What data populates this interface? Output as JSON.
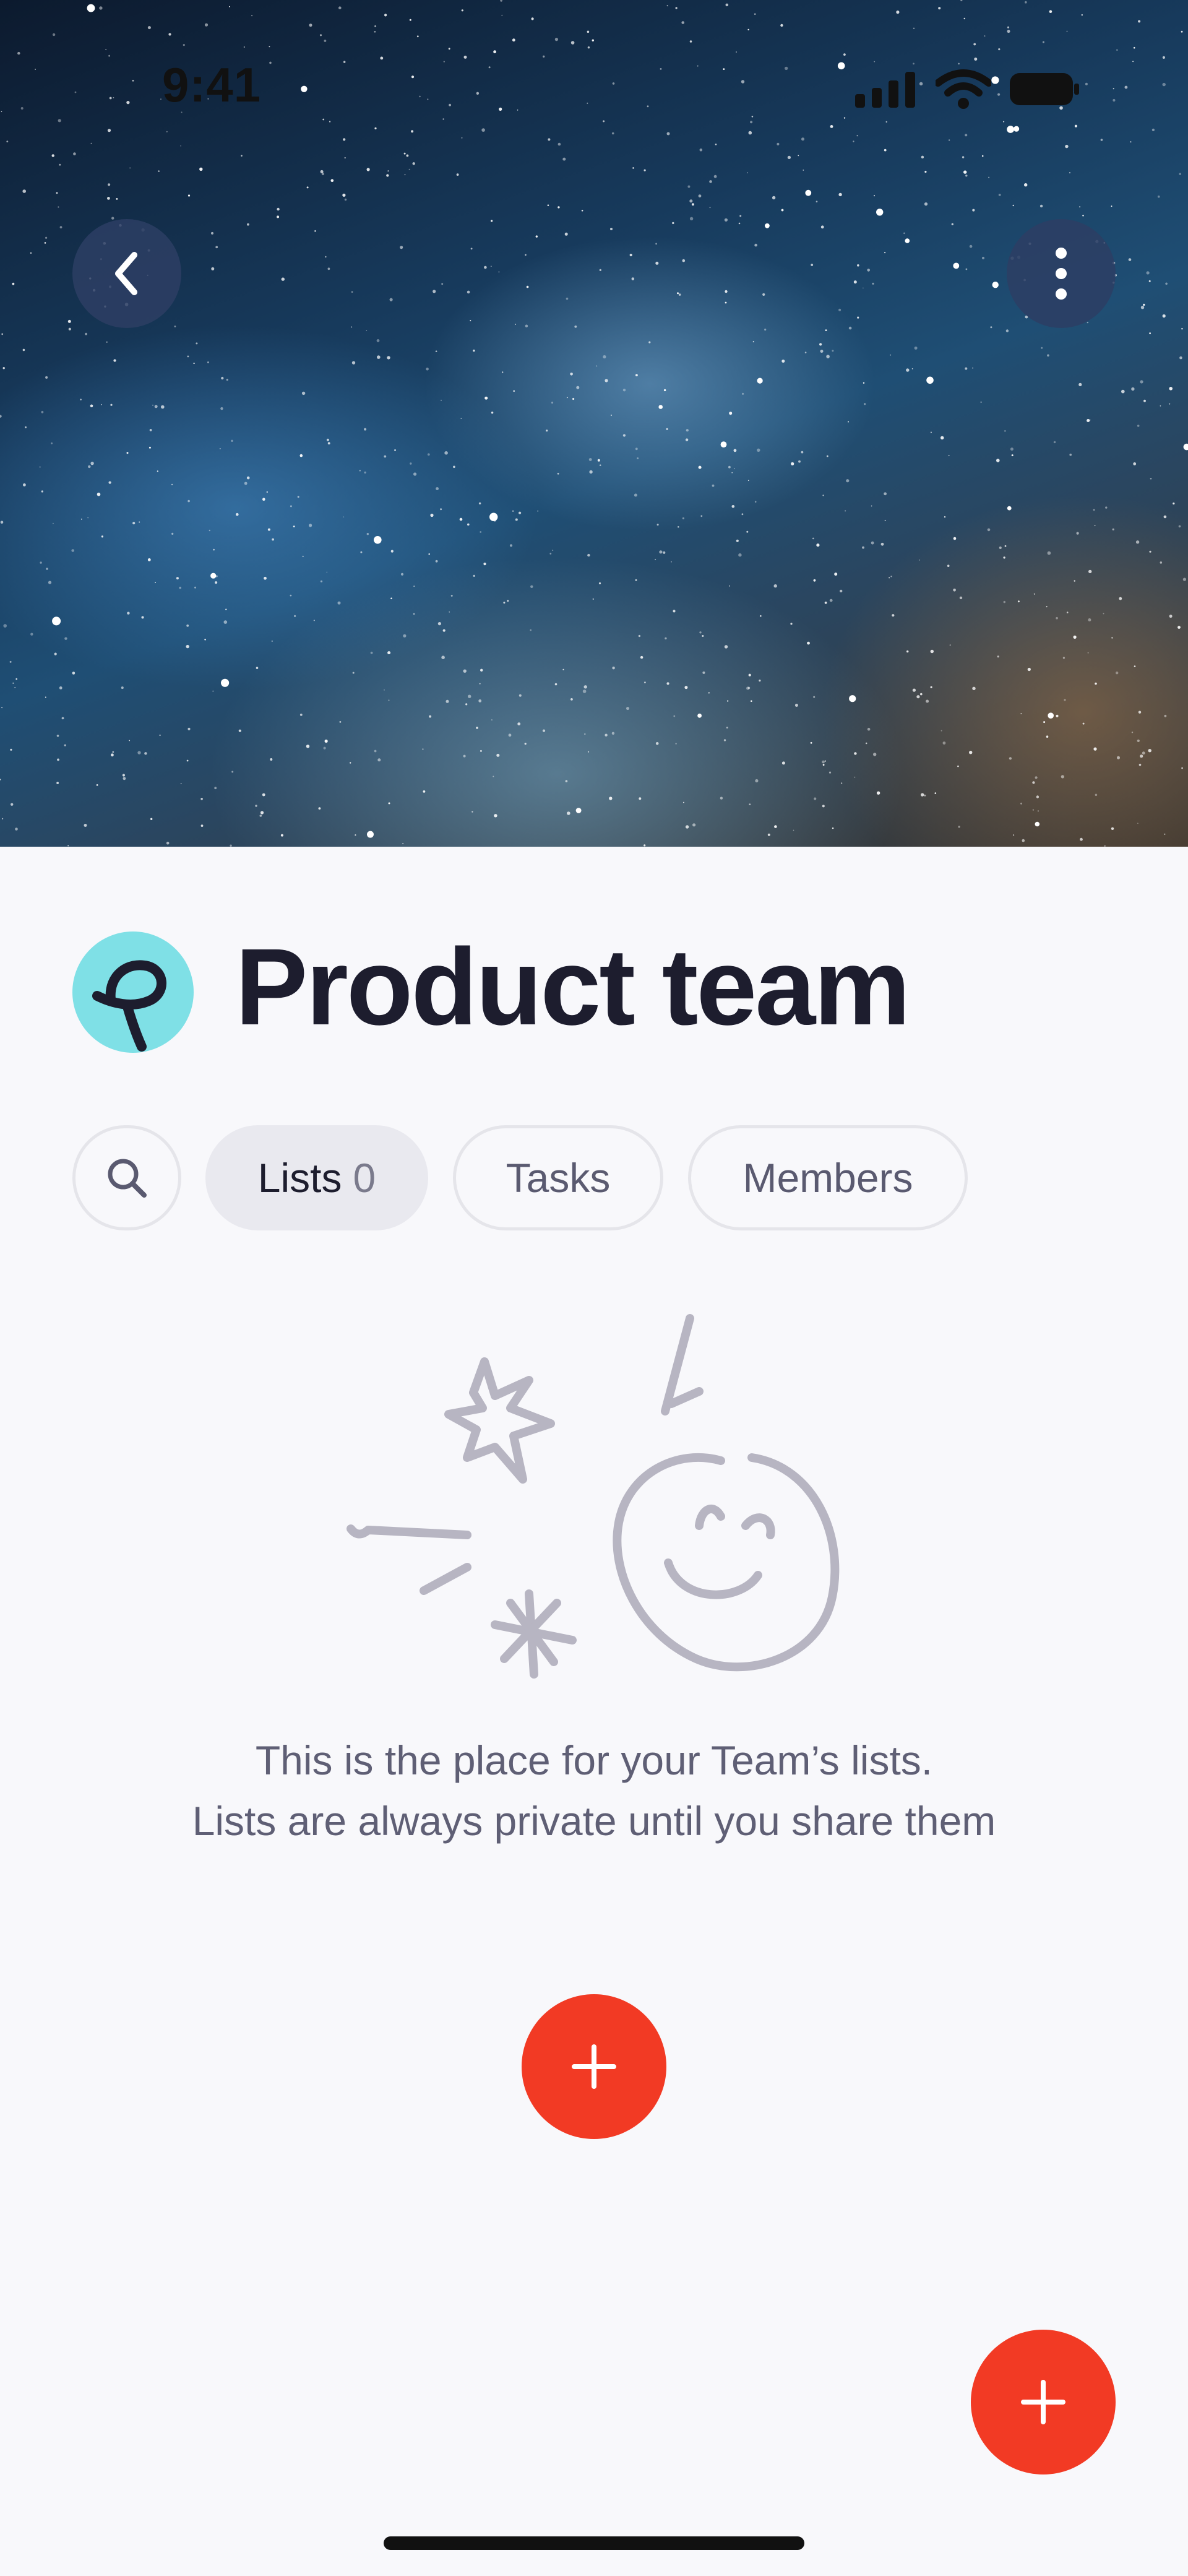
{
  "status_bar": {
    "time": "9:41"
  },
  "header": {
    "back_icon": "chevron-left-icon",
    "more_icon": "more-vertical-icon"
  },
  "team": {
    "name": "Product team",
    "avatar_icon": "team-logo-icon",
    "avatar_color": "#7fe0e6"
  },
  "tabs": {
    "search_icon": "search-icon",
    "lists_label": "Lists",
    "lists_count": "0",
    "tasks_label": "Tasks",
    "members_label": "Members"
  },
  "empty_state": {
    "illustration_icon": "celebration-smiley-illustration",
    "line1": "This is the place for your Team’s lists.",
    "line2": "Lists are always private until you share them"
  },
  "actions": {
    "add_icon": "plus-icon",
    "accent_color": "#f23a24"
  }
}
